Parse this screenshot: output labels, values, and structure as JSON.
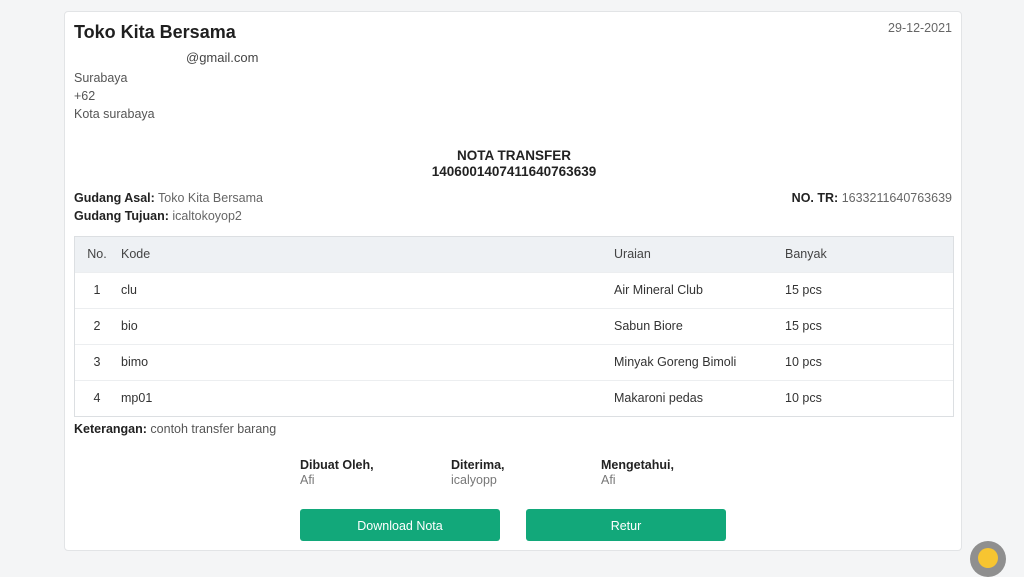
{
  "store": {
    "name": "Toko Kita Bersama",
    "email": "@gmail.com",
    "city": "Surabaya",
    "phone": "+62",
    "region": "Kota surabaya"
  },
  "date": "29-12-2021",
  "document": {
    "title": "NOTA TRANSFER",
    "number": "1406001407411640763639"
  },
  "meta": {
    "gudang_asal_label": "Gudang Asal:",
    "gudang_asal_value": "Toko Kita Bersama",
    "gudang_tujuan_label": "Gudang Tujuan:",
    "gudang_tujuan_value": "icaltokoyop2",
    "no_tr_label": "NO. TR:",
    "no_tr_value": "1633211640763639"
  },
  "table": {
    "headers": {
      "no": "No.",
      "kode": "Kode",
      "uraian": "Uraian",
      "banyak": "Banyak"
    },
    "rows": [
      {
        "no": "1",
        "kode": "clu",
        "uraian": "Air Mineral Club",
        "banyak": "15 pcs"
      },
      {
        "no": "2",
        "kode": "bio",
        "uraian": "Sabun Biore",
        "banyak": "15 pcs"
      },
      {
        "no": "3",
        "kode": "bimo",
        "uraian": "Minyak Goreng Bimoli",
        "banyak": "10 pcs"
      },
      {
        "no": "4",
        "kode": "mp01",
        "uraian": "Makaroni pedas",
        "banyak": "10 pcs"
      }
    ]
  },
  "keterangan": {
    "label": "Keterangan:",
    "value": "contoh transfer barang"
  },
  "signatures": [
    {
      "title": "Dibuat Oleh,",
      "name": "Afi"
    },
    {
      "title": "Diterima,",
      "name": "icalyopp"
    },
    {
      "title": "Mengetahui,",
      "name": "Afi"
    }
  ],
  "buttons": {
    "download": "Download Nota",
    "retur": "Retur"
  },
  "colors": {
    "button": "#12a87a",
    "table_header": "#eef1f4"
  },
  "icons": {
    "chat": "smiley-chat-icon"
  }
}
